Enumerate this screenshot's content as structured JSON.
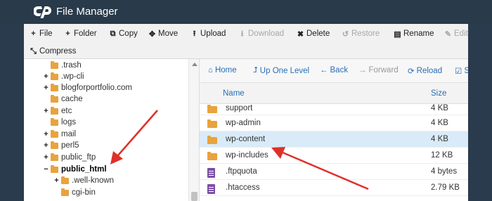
{
  "app": {
    "title": "File Manager",
    "accent": "#2a6eb5"
  },
  "toolbar": {
    "buttons": [
      {
        "label": "File",
        "icon": "plus-icon",
        "glyph": "+",
        "disabled": false
      },
      {
        "label": "Folder",
        "icon": "plus-icon",
        "glyph": "+",
        "disabled": false
      },
      {
        "label": "Copy",
        "icon": "copy-icon",
        "glyph": "⧉",
        "disabled": false
      },
      {
        "label": "Move",
        "icon": "move-icon",
        "glyph": "✥",
        "disabled": false
      },
      {
        "label": "Upload",
        "icon": "upload-icon",
        "glyph": "⭱",
        "disabled": false
      },
      {
        "label": "Download",
        "icon": "download-icon",
        "glyph": "⭳",
        "disabled": true
      },
      {
        "label": "Delete",
        "icon": "delete-icon",
        "glyph": "✖",
        "disabled": false
      },
      {
        "label": "Restore",
        "icon": "restore-icon",
        "glyph": "↺",
        "disabled": true
      },
      {
        "label": "Rename",
        "icon": "rename-icon",
        "glyph": "▤",
        "disabled": false
      },
      {
        "label": "Edit",
        "icon": "edit-icon",
        "glyph": "✎",
        "disabled": true
      },
      {
        "label": "Compress",
        "icon": "compress-icon",
        "glyph": "⤡",
        "disabled": false
      }
    ]
  },
  "tree": {
    "items": [
      {
        "label": ".trash",
        "expander": "",
        "bold": false
      },
      {
        "label": ".wp-cli",
        "expander": "+",
        "bold": false
      },
      {
        "label": "blogforportfolio.com",
        "expander": "+",
        "bold": false
      },
      {
        "label": "cache",
        "expander": "",
        "bold": false
      },
      {
        "label": "etc",
        "expander": "+",
        "bold": false
      },
      {
        "label": "logs",
        "expander": "",
        "bold": false
      },
      {
        "label": "mail",
        "expander": "+",
        "bold": false
      },
      {
        "label": "perl5",
        "expander": "+",
        "bold": false
      },
      {
        "label": "public_ftp",
        "expander": "+",
        "bold": false
      },
      {
        "label": "public_html",
        "expander": "−",
        "bold": true
      },
      {
        "label": ".well-known",
        "expander": "+",
        "bold": false
      },
      {
        "label": "cgi-bin",
        "expander": "",
        "bold": false
      }
    ]
  },
  "nav": {
    "buttons": [
      {
        "label": "Home",
        "icon": "home-icon",
        "glyph": "⌂",
        "disabled": false
      },
      {
        "label": "Up One Level",
        "icon": "up-level-icon",
        "glyph": "⮥",
        "disabled": false
      },
      {
        "label": "Back",
        "icon": "back-arrow-icon",
        "glyph": "←",
        "disabled": false
      },
      {
        "label": "Forward",
        "icon": "forward-arrow-icon",
        "glyph": "→",
        "disabled": true
      },
      {
        "label": "Reload",
        "icon": "reload-icon",
        "glyph": "⟳",
        "disabled": false
      },
      {
        "label": "S",
        "icon": "select-all-icon",
        "glyph": "☑",
        "disabled": false
      }
    ]
  },
  "listing": {
    "columns": {
      "name": "Name",
      "size": "Size"
    },
    "rows": [
      {
        "name": "support",
        "size": "4 KB",
        "type": "folder",
        "selected": false
      },
      {
        "name": "wp-admin",
        "size": "4 KB",
        "type": "folder",
        "selected": false
      },
      {
        "name": "wp-content",
        "size": "4 KB",
        "type": "folder",
        "selected": true
      },
      {
        "name": "wp-includes",
        "size": "12 KB",
        "type": "folder",
        "selected": false
      },
      {
        "name": ".ftpquota",
        "size": "4 bytes",
        "type": "file",
        "selected": false
      },
      {
        "name": ".htaccess",
        "size": "2.79 KB",
        "type": "file",
        "selected": false
      }
    ]
  },
  "annotations": {
    "arrow_color": "#e0302a"
  }
}
